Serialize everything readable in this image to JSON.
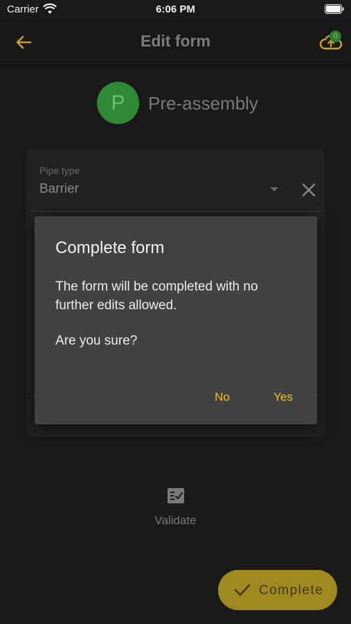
{
  "status_bar": {
    "carrier": "Carrier",
    "time": "6:06 PM"
  },
  "app_bar": {
    "title": "Edit form",
    "sync_badge_count": "0",
    "accent_color": "#f0c419"
  },
  "form_header": {
    "avatar_letter": "P",
    "avatar_color": "#2f8a35",
    "name": "Pre-assembly"
  },
  "field": {
    "label": "Pipe type",
    "value": "Barrier"
  },
  "validate": {
    "label": "Validate"
  },
  "complete_button": {
    "label": "Complete"
  },
  "dialog": {
    "title": "Complete form",
    "body": "The form will be completed with no further edits allowed.",
    "question": "Are you sure?",
    "no_label": "No",
    "yes_label": "Yes"
  },
  "icons": {
    "back": "arrow-left-icon",
    "sync": "cloud-upload-icon",
    "dropdown": "caret-down-icon",
    "clear": "close-icon",
    "validate": "checklist-icon",
    "complete": "check-icon",
    "wifi": "wifi-icon",
    "battery": "battery-icon"
  }
}
